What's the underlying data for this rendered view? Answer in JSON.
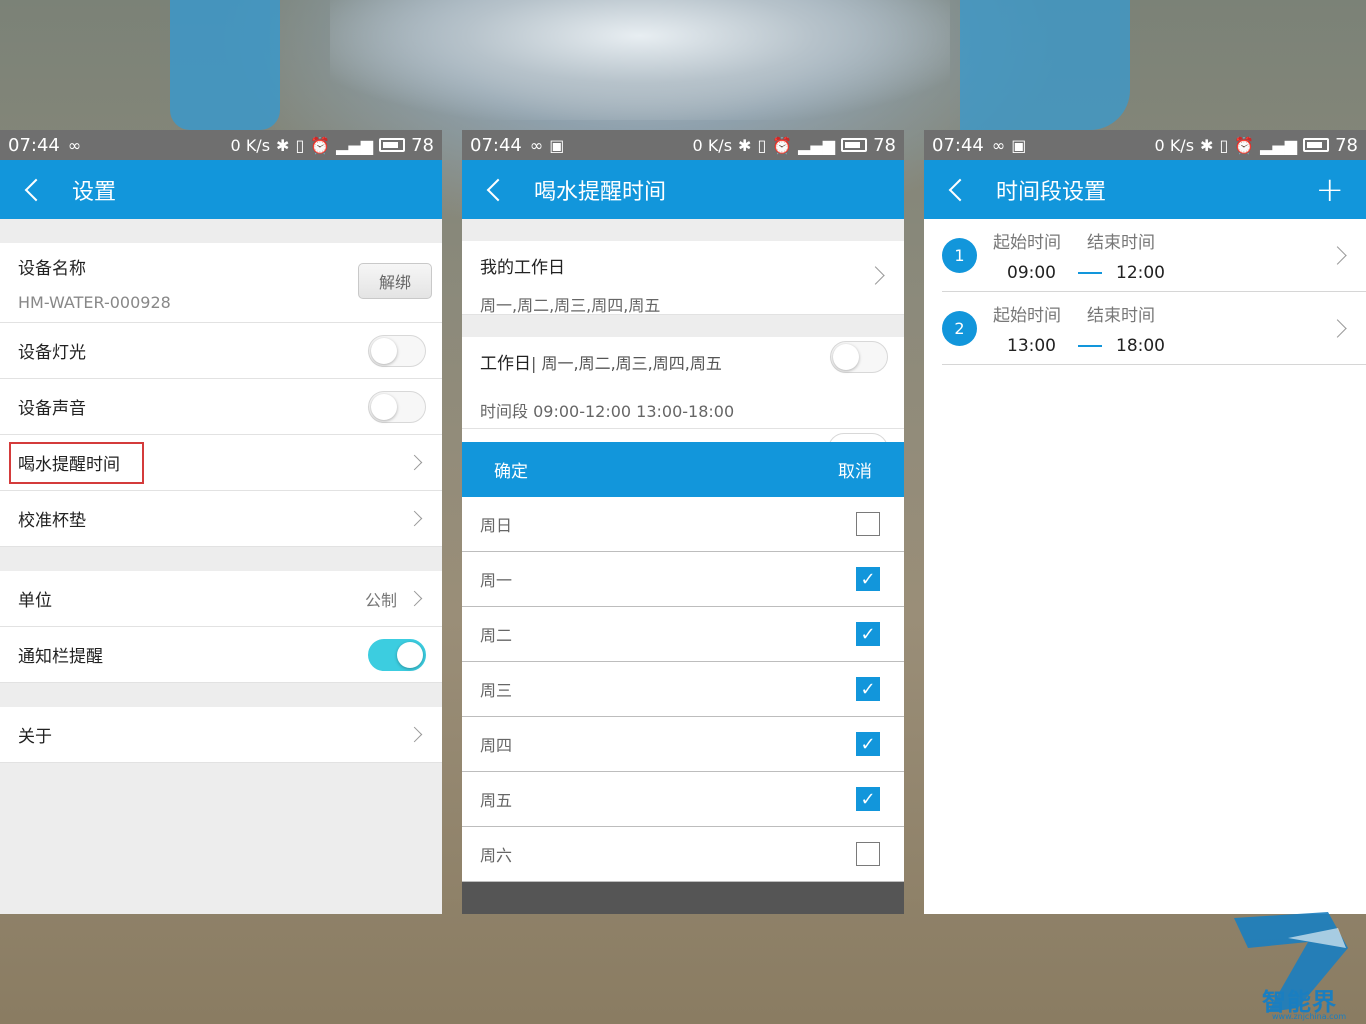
{
  "status_bar": {
    "time": "07:44",
    "net_speed": "0 K/s",
    "battery": "78"
  },
  "screen1": {
    "title": "设置",
    "device_name_label": "设备名称",
    "device_name_value": "HM-WATER-000928",
    "unbind_label": "解绑",
    "items": [
      {
        "label": "设备灯光",
        "toggle": false
      },
      {
        "label": "设备声音",
        "toggle": false
      },
      {
        "label": "喝水提醒时间"
      },
      {
        "label": "校准杯垫"
      }
    ],
    "unit_label": "单位",
    "unit_value": "公制",
    "notify_label": "通知栏提醒",
    "notify_on": true,
    "about_label": "关于"
  },
  "screen2": {
    "title": "喝水提醒时间",
    "my_workdays_label": "我的工作日",
    "my_workdays_value": "周一,周二,周三,周四,周五",
    "workday_label": "工作日",
    "workday_days": "| 周一,周二,周三,周四,周五",
    "timeslots_label": "时间段 09:00-12:00  13:00-18:00",
    "dialog": {
      "confirm": "确定",
      "cancel": "取消",
      "days": [
        {
          "label": "周日",
          "checked": false
        },
        {
          "label": "周一",
          "checked": true
        },
        {
          "label": "周二",
          "checked": true
        },
        {
          "label": "周三",
          "checked": true
        },
        {
          "label": "周四",
          "checked": true
        },
        {
          "label": "周五",
          "checked": true
        },
        {
          "label": "周六",
          "checked": false
        }
      ]
    }
  },
  "screen3": {
    "title": "时间段设置",
    "start_label": "起始时间",
    "end_label": "结束时间",
    "slots": [
      {
        "num": "1",
        "start": "09:00",
        "end": "12:00"
      },
      {
        "num": "2",
        "start": "13:00",
        "end": "18:00"
      }
    ]
  },
  "watermark": {
    "text": "智能界",
    "url": "www.znjchina.com"
  },
  "colors": {
    "primary": "#1296db",
    "toggle_on": "#3ccde0",
    "highlight": "#d43b3b"
  }
}
